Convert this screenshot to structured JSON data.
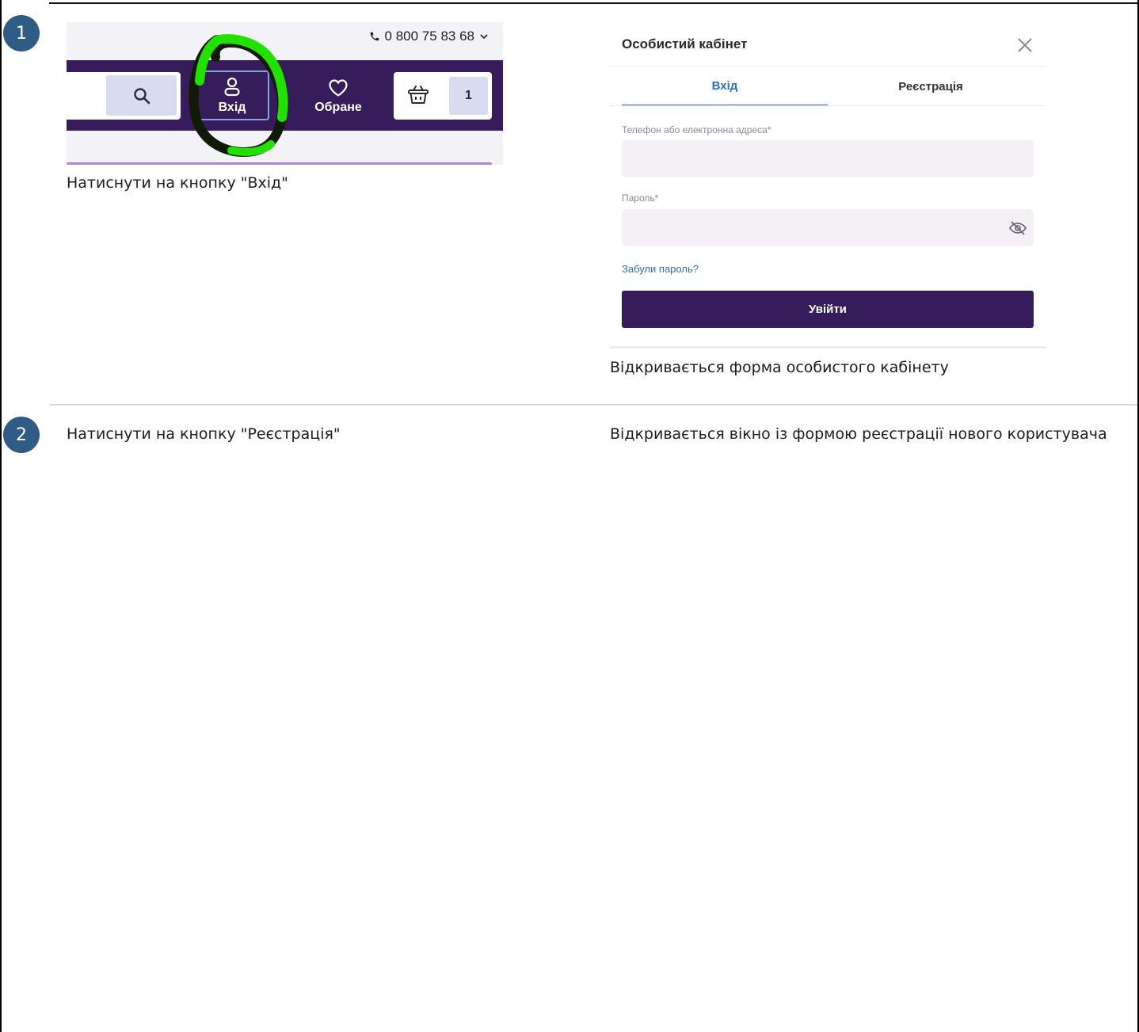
{
  "steps": [
    {
      "number": "1",
      "action": "Натиснути на кнопку \"Вхід\"",
      "result": "Відкривається форма особистого кабінету"
    },
    {
      "number": "2",
      "action": "Натиснути на кнопку \"Реєстрація\"",
      "result": "Відкривається вікно із формою реєстрації нового користувача"
    }
  ],
  "header_screenshot": {
    "phone": "0 800 75 83 68",
    "login_label": "Вхід",
    "favorites_label": "Обране",
    "cart_count": "1",
    "icons": [
      "phone-icon",
      "chevron-down-icon",
      "search-icon",
      "user-icon",
      "heart-icon",
      "basket-icon"
    ],
    "colors": {
      "navbar": "#361c5a",
      "annotation": "#22e000",
      "button_bg": "#d9dbf0"
    }
  },
  "login_modal": {
    "title": "Особистий кабінет",
    "tabs": [
      "Вхід",
      "Реєстрація"
    ],
    "active_tab": "Вхід",
    "phone_email_label": "Телефон або електронна адреса*",
    "phone_email_value": "",
    "password_label": "Пароль*",
    "password_value": "",
    "forgot_password": "Забули пароль?",
    "submit_label": "Увійти",
    "colors": {
      "accent": "#2a6fc0",
      "submit_bg": "#361c5a",
      "field_bg": "#f4f0f6"
    }
  }
}
